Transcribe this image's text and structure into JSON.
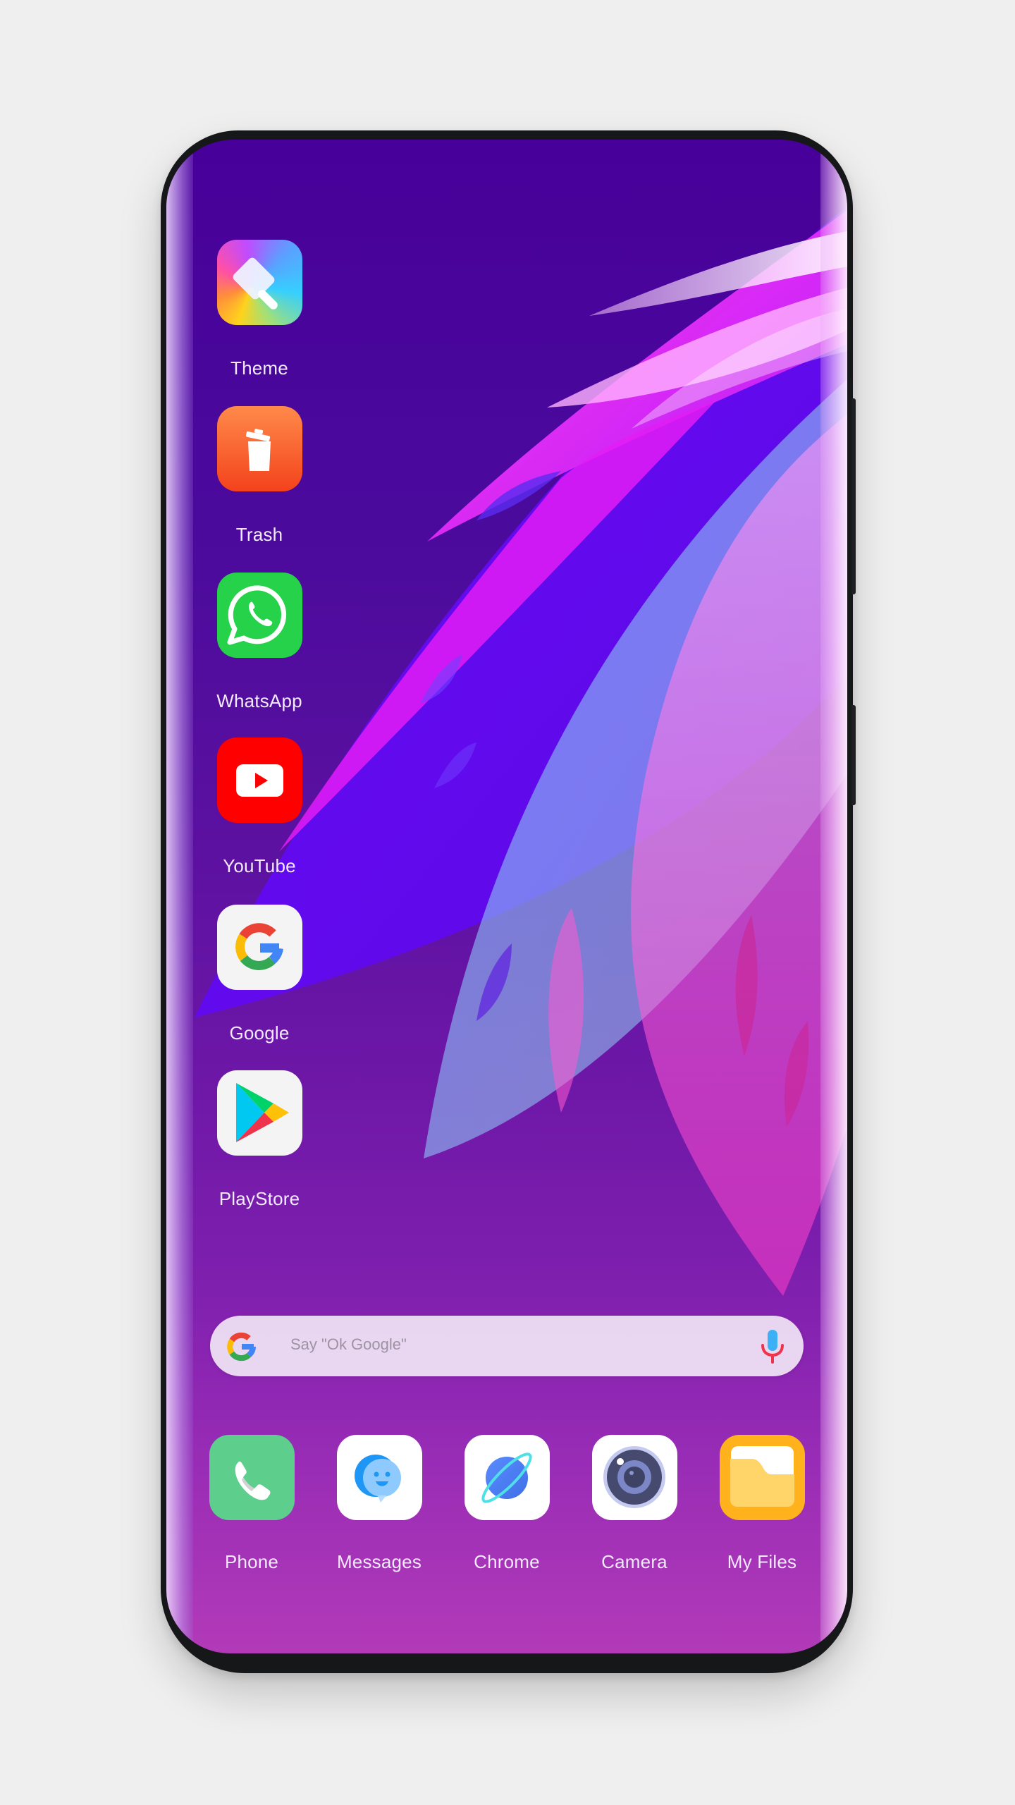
{
  "device": {
    "frame_color": "#161718"
  },
  "home": {
    "apps": [
      {
        "id": "theme",
        "label": "Theme",
        "icon": "paintbrush-icon"
      },
      {
        "id": "trash",
        "label": "Trash",
        "icon": "trash-icon"
      },
      {
        "id": "whatsapp",
        "label": "WhatsApp",
        "icon": "whatsapp-icon"
      },
      {
        "id": "youtube",
        "label": "YouTube",
        "icon": "youtube-play-icon"
      },
      {
        "id": "google",
        "label": "Google",
        "icon": "google-g-icon"
      },
      {
        "id": "playstore",
        "label": "PlayStore",
        "icon": "play-store-icon"
      }
    ]
  },
  "search": {
    "placeholder": "Say \"Ok Google\"",
    "left_icon": "google-g-icon",
    "right_icon": "microphone-icon"
  },
  "dock": {
    "apps": [
      {
        "id": "phone",
        "label": "Phone",
        "icon": "phone-handset-icon"
      },
      {
        "id": "messages",
        "label": "Messages",
        "icon": "chat-bubble-icon"
      },
      {
        "id": "chrome",
        "label": "Chrome",
        "icon": "planet-icon"
      },
      {
        "id": "camera",
        "label": "Camera",
        "icon": "camera-lens-icon"
      },
      {
        "id": "myfiles",
        "label": "My Files",
        "icon": "folder-icon"
      }
    ]
  },
  "colors": {
    "wallpaper_top": "#48009a",
    "wallpaper_bottom": "#b23ab8",
    "label_text": "#f3e9ff",
    "search_bg": "#ede2f1",
    "search_placeholder": "#9d93a3"
  }
}
